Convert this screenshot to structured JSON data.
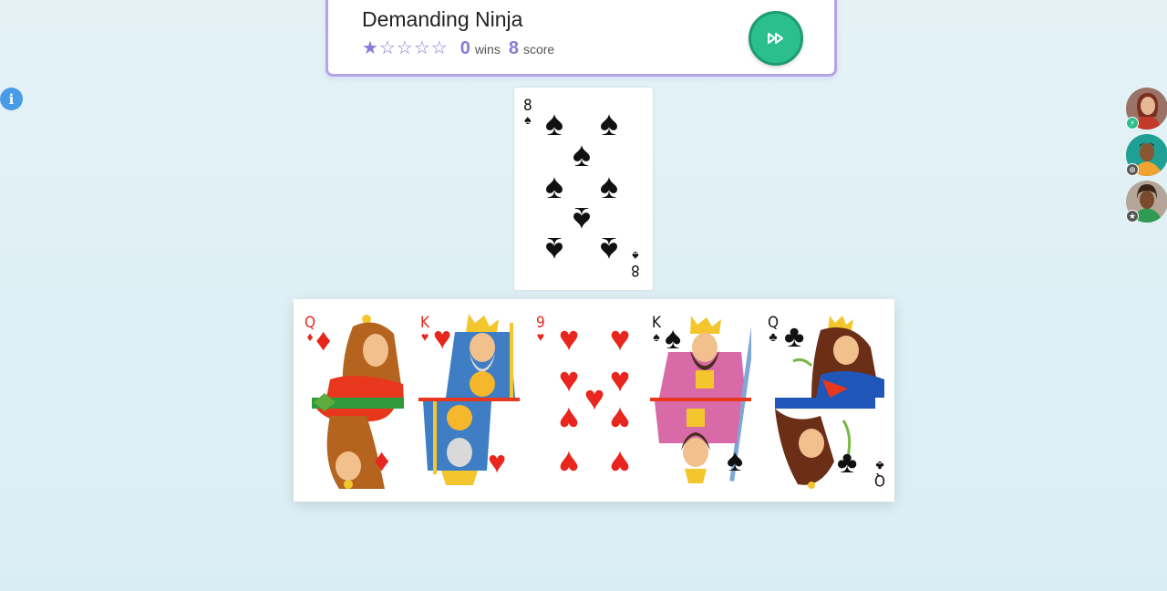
{
  "player": {
    "name": "Demanding Ninja",
    "rating_stars": 1,
    "rating_max": 5,
    "wins": "0",
    "wins_label": "wins",
    "score": "8",
    "score_label": "score"
  },
  "controls": {
    "skip_icon": "fast-forward-icon",
    "info_icon": "info-icon",
    "info_glyph": "i"
  },
  "colors": {
    "accent": "#8b7ad6",
    "panel_border": "#b6a3e8",
    "skip_button": "#2bbf8e",
    "info": "#4a9be6",
    "red_suit": "#e8261d",
    "black_suit": "#111111"
  },
  "pile": {
    "top_card": {
      "rank": "8",
      "suit": "♠",
      "color": "black"
    }
  },
  "hand": [
    {
      "rank": "Q",
      "suit": "♦",
      "color": "red",
      "kind": "queen"
    },
    {
      "rank": "K",
      "suit": "♥",
      "color": "red",
      "kind": "king"
    },
    {
      "rank": "9",
      "suit": "♥",
      "color": "red",
      "kind": "number"
    },
    {
      "rank": "K",
      "suit": "♠",
      "color": "black",
      "kind": "king"
    },
    {
      "rank": "Q",
      "suit": "♣",
      "color": "black",
      "kind": "queen"
    }
  ],
  "opponents": [
    {
      "avatar": "avatar-woman-red-hair",
      "status_icon": "lightning-icon",
      "badge_color": "#2bbf8e"
    },
    {
      "avatar": "avatar-man-teal-shirt",
      "status_icon": "crosshair-icon",
      "badge_color": "#555555"
    },
    {
      "avatar": "avatar-man-green-shirt",
      "status_icon": "star-icon",
      "badge_color": "#555555"
    }
  ]
}
